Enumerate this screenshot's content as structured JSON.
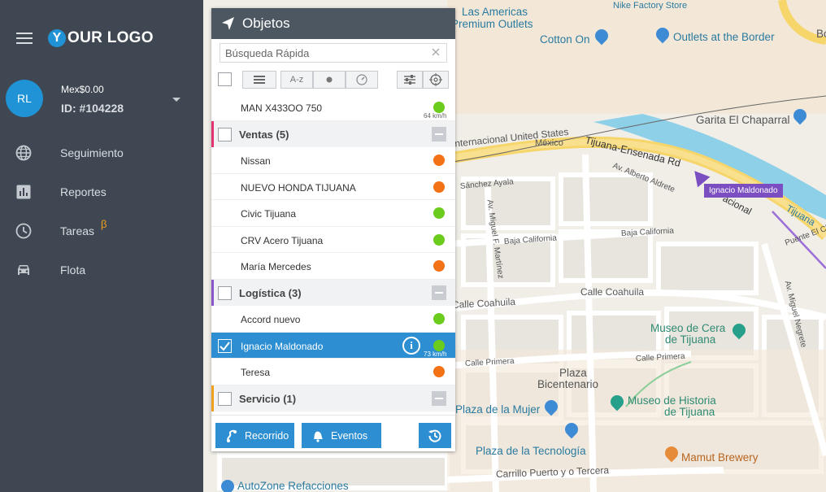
{
  "sidebar": {
    "logo_y": "Y",
    "logo_text": "OUR LOGO",
    "avatar_initials": "RL",
    "balance": "Mex$0.00",
    "account_id": "ID: #104228",
    "nav": [
      {
        "label": "Seguimiento",
        "icon": "globe-icon"
      },
      {
        "label": "Reportes",
        "icon": "bar-chart-icon"
      },
      {
        "label": "Tareas",
        "icon": "clock-icon",
        "badge": "β"
      },
      {
        "label": "Flota",
        "icon": "car-icon"
      }
    ]
  },
  "panel": {
    "title": "Objetos",
    "search_placeholder": "Búsqueda Rápida",
    "sort_label": "A-z",
    "items": [
      {
        "kind": "vehicle",
        "name": "MAN X433OO 750",
        "status": "green",
        "speed": "64 km/h"
      },
      {
        "kind": "group",
        "name": "Ventas (5)",
        "color": "#e0336f"
      },
      {
        "kind": "vehicle",
        "name": "Nissan",
        "status": "orange"
      },
      {
        "kind": "vehicle",
        "name": "NUEVO HONDA TIJUANA",
        "status": "orange"
      },
      {
        "kind": "vehicle",
        "name": "Civic Tijuana",
        "status": "green"
      },
      {
        "kind": "vehicle",
        "name": "CRV Acero Tijuana",
        "status": "green"
      },
      {
        "kind": "vehicle",
        "name": "María Mercedes",
        "status": "orange"
      },
      {
        "kind": "group",
        "name": "Logística (3)",
        "color": "#8a55c9"
      },
      {
        "kind": "vehicle",
        "name": "Accord nuevo",
        "status": "green"
      },
      {
        "kind": "vehicle",
        "name": "Ignacio Maldonado",
        "status": "green",
        "speed": "73 km/h",
        "selected": true
      },
      {
        "kind": "vehicle",
        "name": "Teresa",
        "status": "orange"
      },
      {
        "kind": "group",
        "name": "Servicio (1)",
        "color": "#f0a020"
      }
    ],
    "footer": {
      "route_label": "Recorrido",
      "events_label": "Eventos"
    }
  },
  "colors": {
    "green": "#6ccc1e",
    "orange": "#f47216",
    "accent": "#2d8fd2"
  },
  "map": {
    "vehicle_tag": "Ignacio Maldonado",
    "pois": {
      "las_americas_1": "Las Americas",
      "las_americas_2": "Premium Outlets",
      "cotton_on": "Cotton On",
      "outlets_border": "Outlets at the Border",
      "nike": "Nike Factory Store",
      "garita": "Garita El Chaparral",
      "museo_cera_1": "Museo de Cera",
      "museo_cera_2": "de Tijuana",
      "plaza_bicentenario_1": "Plaza",
      "plaza_bicentenario_2": "Bicentenario",
      "plaza_mujer": "Plaza de la Mujer",
      "museo_historia_1": "Museo de Historia",
      "museo_historia_2": "de Tijuana",
      "plaza_tecnologia": "Plaza de la Tecnología",
      "mamut": "Mamut Brewery",
      "autozone": "AutoZone Refacciones",
      "bo": "Bo"
    },
    "streets": {
      "internacional": "Internacional United States",
      "mexico": "México",
      "tijuana_ensenada": "Tijuana-Ensenada Rd",
      "nacional": "acional",
      "tijuana_river": "Tijuana",
      "puente": "Puente El Ch",
      "alberto": "Av. Alberto Aldrete",
      "sanchez": "Sánchez Ayala",
      "miguel_f": "Av. Miguel F. Martínez",
      "baja1": "Baja California",
      "baja2": "Baja California",
      "coahuila1": "Calle Coahuila",
      "coahuila2": "Calle Coahuila",
      "primera1": "Calle Primera",
      "primera2": "Calle Primera",
      "miguel_n": "Av. Miguel Negrete",
      "carrillo": "Carrillo Puerto y o Tercera"
    }
  }
}
